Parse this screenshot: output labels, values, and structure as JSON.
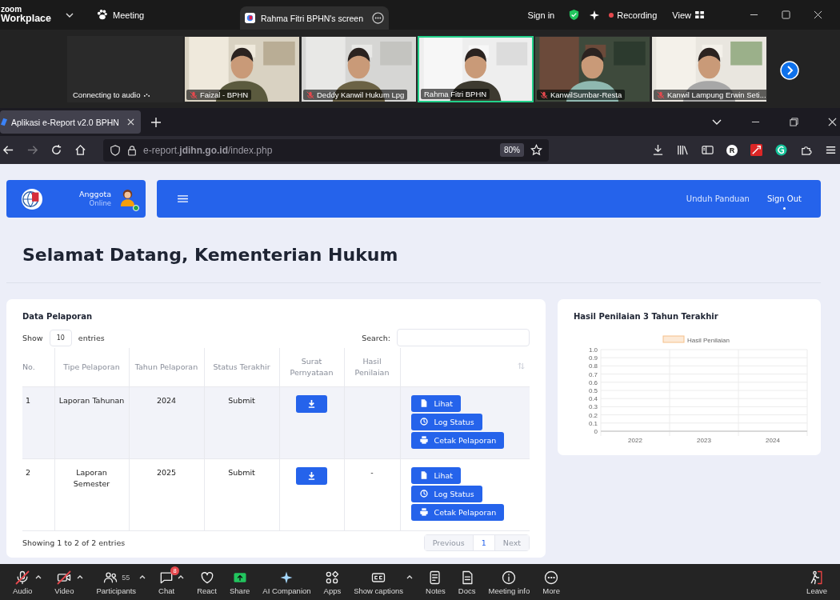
{
  "zoom_bar": {
    "logo_top": "zoom",
    "logo_bottom": "Workplace",
    "meeting": "Meeting",
    "share_tab": "Rahma Fitri BPHN's screen",
    "sign_in": "Sign in",
    "recording": "Recording",
    "view": "View"
  },
  "tiles": [
    {
      "kind": "no-video",
      "name": "Connecting to audio",
      "muted": false,
      "speaking": false
    },
    {
      "kind": "video",
      "name": "Faizal - BPHN",
      "muted": true,
      "speaking": false
    },
    {
      "kind": "video",
      "name": "Deddy Kanwil Hukum Lpg",
      "muted": true,
      "speaking": false
    },
    {
      "kind": "video",
      "name": "Rahma Fitri BPHN",
      "muted": false,
      "speaking": true
    },
    {
      "kind": "video",
      "name": "KanwilSumbar-Resta",
      "muted": true,
      "speaking": false
    },
    {
      "kind": "video",
      "name": "Kanwil Lampung Erwin Seti...",
      "muted": true,
      "speaking": false
    }
  ],
  "browser": {
    "tab": "Aplikasi e-Report v2.0 BPHN",
    "url": "e-report.**jdihn.go.id**/index.php",
    "zoom": "80%",
    "forward_disabled": true,
    "profile": "R"
  },
  "header": {
    "role": "Anggota",
    "status": "Online",
    "links": [
      {
        "label": "Unduh Panduan",
        "selected": false
      },
      {
        "label": "Sign Out",
        "selected": true
      }
    ]
  },
  "title": "Selamat Datang, Kementerian Hukum",
  "table_card": {
    "title": "Data Pelaporan",
    "show": "Show",
    "page_size": "10",
    "entries": "entries",
    "search_label": "Search:",
    "columns": [
      "No.",
      "Tipe Pelaporan",
      "Tahun Pelaporan",
      "Status Terakhir",
      "Surat Pernyataan",
      "Hasil Penilaian"
    ],
    "rows": [
      {
        "no": "1",
        "type": "Laporan Tahunan",
        "year": "2024",
        "status": "Submit",
        "actions": [
          {
            "kind": "view",
            "label": "Lihat"
          },
          {
            "kind": "log",
            "label": "Log Status"
          },
          {
            "kind": "print",
            "label": "Cetak Pelaporan"
          }
        ]
      },
      {
        "no": "2",
        "type": "Laporan Semester",
        "year": "2025",
        "status": "Submit",
        "result": "-",
        "actions": [
          {
            "kind": "view",
            "label": "Lihat"
          },
          {
            "kind": "log",
            "label": "Log Status"
          },
          {
            "kind": "print",
            "label": "Cetak Pelaporan"
          }
        ]
      }
    ],
    "info": "Showing 1 to 2 of 2 entries",
    "pagination": [
      {
        "label": "Previous",
        "selected": false,
        "disabled": true
      },
      {
        "label": "1",
        "selected": true,
        "disabled": false
      },
      {
        "label": "Next",
        "selected": false,
        "disabled": true
      }
    ]
  },
  "chart_card": {
    "title": "Hasil Penilaian 3 Tahun Terakhir",
    "chart_data": {
      "type": "bar",
      "grid": true,
      "categories": [
        "2022",
        "2023",
        "2024"
      ],
      "series": [
        {
          "name": "Hasil Penilaian",
          "color": "#f6c08a",
          "values": [
            null,
            null,
            null
          ]
        }
      ],
      "ylim": [
        0,
        1
      ],
      "yticks": [
        0,
        0.1,
        0.2,
        0.3,
        0.4,
        0.5,
        0.6,
        0.7,
        0.8,
        0.9,
        {
          "value": 1,
          "label": "1.0"
        }
      ]
    }
  },
  "toolbar": [
    {
      "label": "Audio",
      "caret": true,
      "off": true
    },
    {
      "label": "Video",
      "caret": true,
      "off": true
    },
    {
      "label": "Participants",
      "count": "55",
      "caret": true,
      "off": false
    },
    {
      "label": "Chat",
      "badge": "8",
      "caret": true,
      "off": false
    },
    {
      "label": "React",
      "caret": false,
      "off": false
    },
    {
      "label": "Share",
      "caret": false,
      "off": false
    },
    {
      "label": "AI Companion",
      "caret": false,
      "off": false
    },
    {
      "label": "Apps",
      "caret": false,
      "off": false
    },
    {
      "label": "Show captions",
      "caret": true,
      "off": false
    },
    {
      "label": "Notes",
      "caret": false,
      "off": false
    },
    {
      "label": "Docs",
      "caret": false,
      "off": false
    },
    {
      "label": "Meeting info",
      "caret": false,
      "off": false
    },
    {
      "label": "More",
      "caret": false,
      "off": false
    },
    {
      "label": "Leave",
      "caret": false,
      "off": false
    }
  ]
}
